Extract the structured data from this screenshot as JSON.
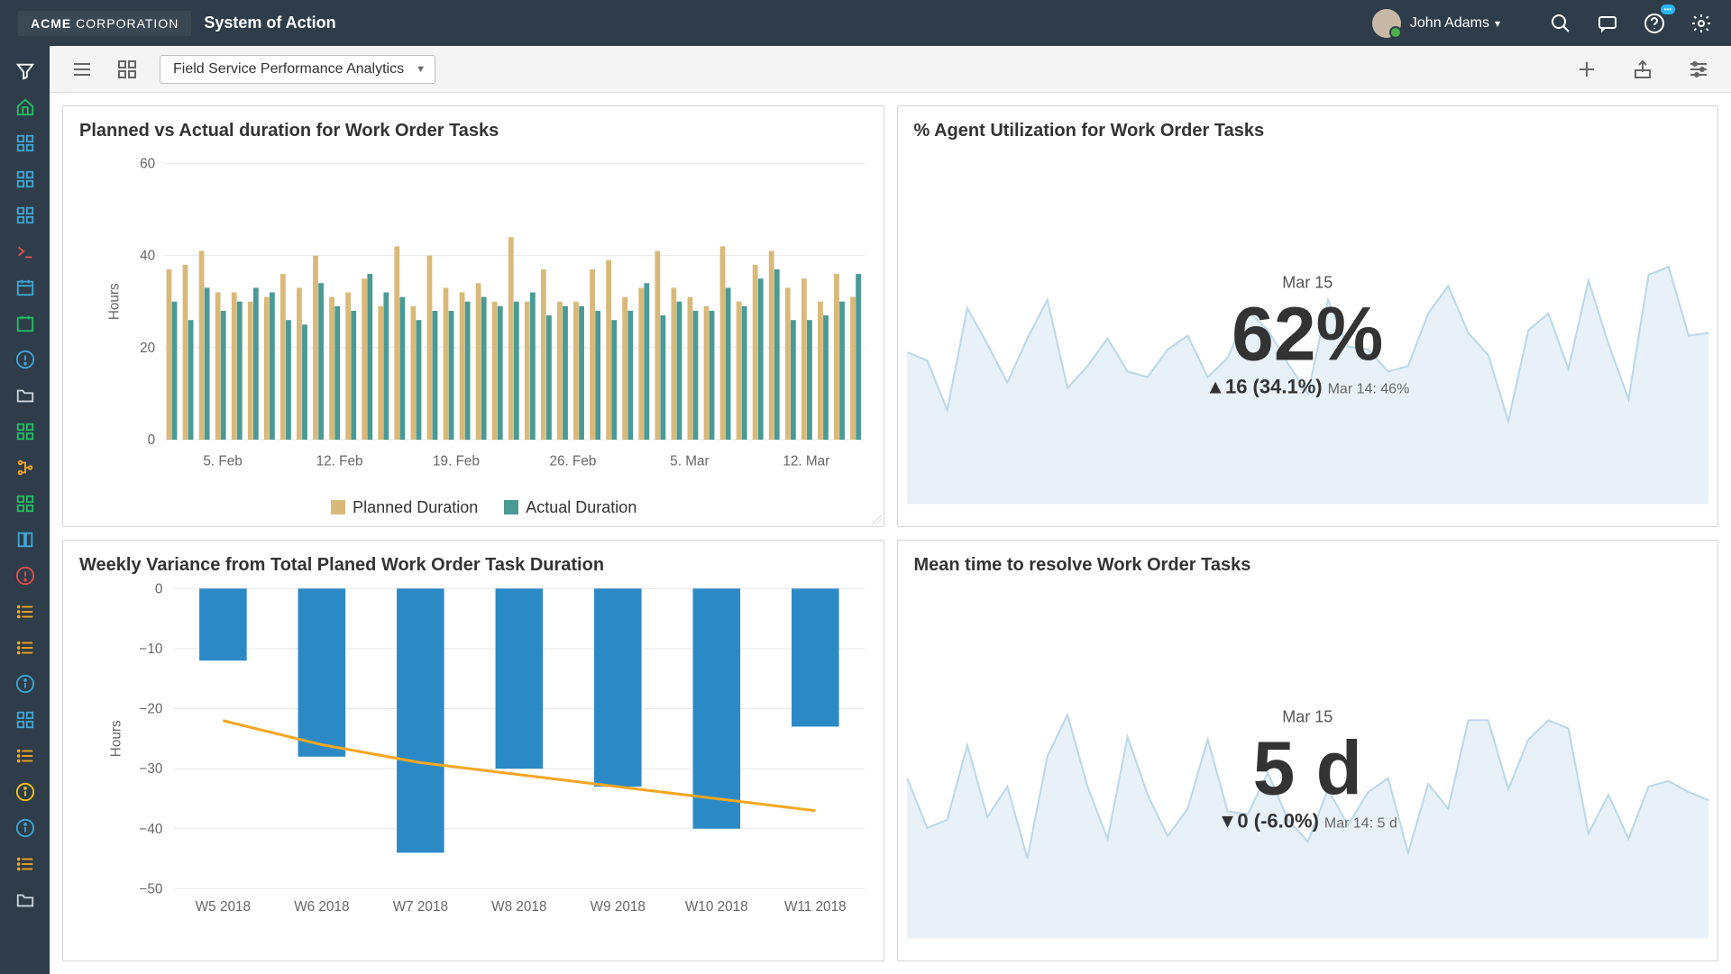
{
  "header": {
    "brand_prefix": "ACME",
    "brand_suffix": " CORPORATION",
    "page_title": "System of Action",
    "user_name": "John Adams"
  },
  "toolbar": {
    "dashboard_select": "Field Service Performance Analytics"
  },
  "rail_icons": [
    {
      "name": "filter-icon",
      "color": "#ffffff"
    },
    {
      "name": "home-icon",
      "color": "#21c063"
    },
    {
      "name": "grid-icon",
      "color": "#3fa7d6"
    },
    {
      "name": "grid-icon",
      "color": "#3fa7d6"
    },
    {
      "name": "grid-icon",
      "color": "#3fa7d6"
    },
    {
      "name": "terminal-icon",
      "color": "#e04f4f"
    },
    {
      "name": "calendar-icon",
      "color": "#3fa7d6"
    },
    {
      "name": "calendar-plain-icon",
      "color": "#21c063"
    },
    {
      "name": "alert-circle-icon",
      "color": "#3fa7d6"
    },
    {
      "name": "folder-icon",
      "color": "#cfd5da"
    },
    {
      "name": "grid-icon",
      "color": "#21c063"
    },
    {
      "name": "tree-icon",
      "color": "#f5a623"
    },
    {
      "name": "grid-icon",
      "color": "#21c063"
    },
    {
      "name": "book-icon",
      "color": "#3fa7d6"
    },
    {
      "name": "alert-circle-icon",
      "color": "#e04f4f"
    },
    {
      "name": "list-icon",
      "color": "#f5a623"
    },
    {
      "name": "list-icon",
      "color": "#f5a623"
    },
    {
      "name": "info-icon",
      "color": "#3fa7d6"
    },
    {
      "name": "grid-icon",
      "color": "#3fa7d6"
    },
    {
      "name": "list-icon",
      "color": "#f5a623"
    },
    {
      "name": "info-icon",
      "color": "#f5c518"
    },
    {
      "name": "info-icon",
      "color": "#3fa7d6"
    },
    {
      "name": "list-icon",
      "color": "#f5a623"
    },
    {
      "name": "folder-icon",
      "color": "#cfd5da"
    }
  ],
  "cards": {
    "planned_vs_actual": {
      "title": "Planned vs Actual duration for Work Order Tasks",
      "legend_planned": "Planned Duration",
      "legend_actual": "Actual Duration"
    },
    "agent_util": {
      "title": "% Agent Utilization for Work Order Tasks",
      "date": "Mar 15",
      "value": "62%",
      "delta": "▲16 (34.1%)",
      "prev": "Mar 14: 46%"
    },
    "weekly_variance": {
      "title": "Weekly Variance from Total Planed Work Order Task Duration"
    },
    "mttr": {
      "title": "Mean time to resolve Work Order Tasks",
      "date": "Mar 15",
      "value": "5 d",
      "delta": "▼0 (-6.0%)",
      "prev": "Mar 14: 5 d"
    }
  },
  "chart_data": [
    {
      "id": "planned_vs_actual",
      "type": "bar",
      "ylabel": "Hours",
      "ylim": [
        0,
        60
      ],
      "yticks": [
        0,
        20,
        40,
        60
      ],
      "x_tick_labels": [
        "5. Feb",
        "12. Feb",
        "19. Feb",
        "26. Feb",
        "5. Mar",
        "12. Mar"
      ],
      "series": [
        {
          "name": "Planned Duration",
          "color": "#d9b97a",
          "values": [
            37,
            38,
            41,
            32,
            32,
            30,
            31,
            36,
            33,
            40,
            31,
            32,
            35,
            29,
            42,
            29,
            40,
            33,
            32,
            34,
            30,
            44,
            30,
            37,
            30,
            30,
            37,
            39,
            31,
            33,
            41,
            33,
            31,
            29,
            42,
            30,
            38,
            41,
            33,
            35,
            30,
            36,
            31
          ]
        },
        {
          "name": "Actual Duration",
          "color": "#4a9a95",
          "values": [
            30,
            26,
            33,
            28,
            30,
            33,
            32,
            26,
            25,
            34,
            29,
            28,
            36,
            32,
            31,
            26,
            28,
            28,
            30,
            31,
            29,
            30,
            32,
            27,
            29,
            29,
            28,
            26,
            28,
            34,
            27,
            30,
            28,
            28,
            33,
            29,
            35,
            37,
            26,
            26,
            27,
            30,
            36
          ]
        }
      ]
    },
    {
      "id": "agent_util",
      "type": "area",
      "ylim": [
        0,
        100
      ],
      "series": [
        {
          "name": "% Utilization",
          "color": "#bcd8e8",
          "values": [
            55,
            52,
            34,
            71,
            58,
            44,
            60,
            74,
            42,
            50,
            60,
            48,
            46,
            56,
            61,
            46,
            53,
            70,
            63,
            51,
            40,
            74,
            57,
            56,
            48,
            50,
            69,
            79,
            62,
            54,
            30,
            63,
            69,
            49,
            81,
            58,
            38,
            83,
            86,
            61,
            62
          ]
        }
      ]
    },
    {
      "id": "weekly_variance",
      "type": "bar",
      "ylabel": "Hours",
      "ylim": [
        -50,
        0
      ],
      "yticks": [
        0,
        -10,
        -20,
        -30,
        -40,
        -50
      ],
      "categories": [
        "W5 2018",
        "W6 2018",
        "W7 2018",
        "W8 2018",
        "W9 2018",
        "W10 2018",
        "W11 2018"
      ],
      "series": [
        {
          "name": "Variance",
          "color": "#2b8ac6",
          "values": [
            -12,
            -28,
            -44,
            -30,
            -33,
            -40,
            -23
          ]
        },
        {
          "name": "Trend",
          "type": "line",
          "color": "#f5a623",
          "values": [
            -22,
            -26,
            -29,
            -31,
            -33,
            -35,
            -37
          ]
        }
      ]
    },
    {
      "id": "mttr",
      "type": "area",
      "ylim": [
        0,
        10
      ],
      "series": [
        {
          "name": "Days",
          "color": "#bcd8e8",
          "values": [
            5.8,
            4.0,
            4.3,
            7.0,
            4.4,
            5.5,
            2.9,
            6.6,
            8.1,
            5.5,
            3.6,
            7.3,
            5.2,
            3.7,
            4.7,
            7.2,
            4.6,
            4.5,
            6.0,
            4.3,
            3.5,
            5.4,
            4.1,
            5.3,
            5.8,
            3.1,
            5.6,
            4.7,
            7.9,
            7.9,
            5.4,
            7.2,
            7.9,
            7.6,
            3.8,
            5.2,
            3.6,
            5.5,
            5.7,
            5.3,
            5.0
          ]
        }
      ]
    }
  ]
}
